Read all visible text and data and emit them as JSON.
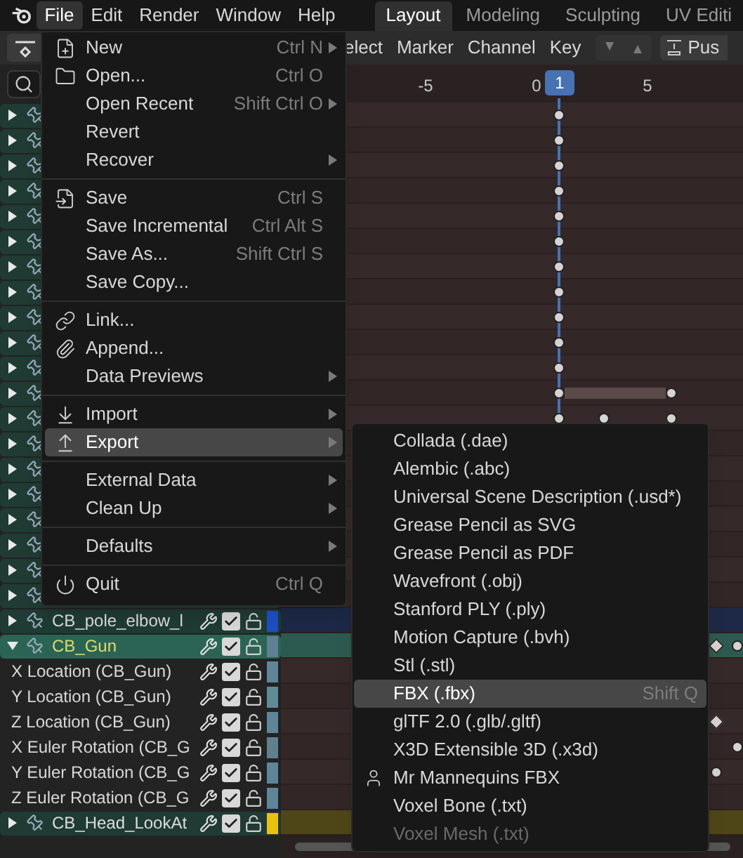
{
  "menubar": {
    "items": [
      {
        "label": "File",
        "selected": true
      },
      {
        "label": "Edit",
        "selected": false
      },
      {
        "label": "Render",
        "selected": false
      },
      {
        "label": "Window",
        "selected": false
      },
      {
        "label": "Help",
        "selected": false
      }
    ]
  },
  "workspace_tabs": [
    {
      "label": "Layout",
      "selected": true
    },
    {
      "label": "Modeling",
      "selected": false
    },
    {
      "label": "Sculpting",
      "selected": false
    },
    {
      "label": "UV Editi",
      "selected": false
    }
  ],
  "editor_header": {
    "menus": [
      "elect",
      "Marker",
      "Channel",
      "Key"
    ],
    "push_button": "Pus"
  },
  "ruler": {
    "ticks": [
      "-5",
      "0",
      "5"
    ],
    "current_frame": "1"
  },
  "channels": [
    {
      "kind": "group",
      "expanded": false
    },
    {
      "kind": "group",
      "expanded": false
    },
    {
      "kind": "group",
      "expanded": false
    },
    {
      "kind": "group",
      "expanded": false
    },
    {
      "kind": "group",
      "expanded": false
    },
    {
      "kind": "group",
      "expanded": false
    },
    {
      "kind": "group",
      "expanded": false
    },
    {
      "kind": "group",
      "expanded": false
    },
    {
      "kind": "group",
      "expanded": false
    },
    {
      "kind": "group",
      "expanded": false
    },
    {
      "kind": "group",
      "expanded": false
    },
    {
      "kind": "group",
      "expanded": false
    },
    {
      "kind": "group",
      "expanded": false
    },
    {
      "kind": "group",
      "expanded": false
    },
    {
      "kind": "group",
      "expanded": false
    },
    {
      "kind": "group",
      "expanded": false
    },
    {
      "kind": "group",
      "expanded": false
    },
    {
      "kind": "group",
      "expanded": false
    },
    {
      "kind": "group",
      "expanded": false
    },
    {
      "kind": "group",
      "expanded": false
    },
    {
      "kind": "group",
      "name": "CB_pole_elbow_l",
      "expanded": false,
      "selected": false,
      "checked": true,
      "color": "#1f4fc4"
    },
    {
      "kind": "group",
      "name": "CB_Gun",
      "expanded": true,
      "selected": true,
      "checked": true,
      "color": "#5f7f94"
    },
    {
      "kind": "curve",
      "name": "X Location (CB_Gun)",
      "checked": true,
      "color": "#5f8598"
    },
    {
      "kind": "curve",
      "name": "Y Location (CB_Gun)",
      "checked": true,
      "color": "#5f8b98"
    },
    {
      "kind": "curve",
      "name": "Z Location (CB_Gun)",
      "checked": true,
      "color": "#5f8598"
    },
    {
      "kind": "curve",
      "name": "X Euler Rotation (CB_G",
      "checked": true,
      "color": "#61808e"
    },
    {
      "kind": "curve",
      "name": "Y Euler Rotation (CB_G",
      "checked": true,
      "color": "#5f8598"
    },
    {
      "kind": "curve",
      "name": "Z Euler Rotation (CB_G",
      "checked": true,
      "color": "#5f8598"
    },
    {
      "kind": "group",
      "name": "CB_Head_LookAt",
      "expanded": false,
      "selected": false,
      "checked": true,
      "color": "#e8c20c"
    }
  ],
  "file_menu": {
    "sections": [
      [
        {
          "label": "New",
          "shortcut": "Ctrl N",
          "submenu": true,
          "selected": false
        },
        {
          "label": "Open...",
          "shortcut": "Ctrl O",
          "submenu": false,
          "selected": false
        },
        {
          "label": "Open Recent",
          "shortcut": "Shift Ctrl O",
          "submenu": true,
          "selected": false
        },
        {
          "label": "Revert",
          "submenu": false,
          "selected": false
        },
        {
          "label": "Recover",
          "submenu": true,
          "selected": false
        }
      ],
      [
        {
          "label": "Save",
          "shortcut": "Ctrl S",
          "submenu": false,
          "selected": false
        },
        {
          "label": "Save Incremental",
          "shortcut": "Ctrl Alt S",
          "submenu": false,
          "selected": false
        },
        {
          "label": "Save As...",
          "shortcut": "Shift Ctrl S",
          "submenu": false,
          "selected": false
        },
        {
          "label": "Save Copy...",
          "submenu": false,
          "selected": false
        }
      ],
      [
        {
          "label": "Link...",
          "submenu": false,
          "selected": false
        },
        {
          "label": "Append...",
          "submenu": false,
          "selected": false
        },
        {
          "label": "Data Previews",
          "submenu": true,
          "selected": false
        }
      ],
      [
        {
          "label": "Import",
          "submenu": true,
          "selected": false
        },
        {
          "label": "Export",
          "submenu": true,
          "selected": true
        }
      ],
      [
        {
          "label": "External Data",
          "submenu": true,
          "selected": false
        },
        {
          "label": "Clean Up",
          "submenu": true,
          "selected": false
        }
      ],
      [
        {
          "label": "Defaults",
          "submenu": true,
          "selected": false
        }
      ],
      [
        {
          "label": "Quit",
          "shortcut": "Ctrl Q",
          "submenu": false,
          "selected": false
        }
      ]
    ]
  },
  "export_menu": {
    "items": [
      {
        "label": "Collada (.dae)",
        "selected": false,
        "disabled": false
      },
      {
        "label": "Alembic (.abc)",
        "selected": false,
        "disabled": false
      },
      {
        "label": "Universal Scene Description (.usd*)",
        "selected": false,
        "disabled": false
      },
      {
        "label": "Grease Pencil as SVG",
        "selected": false,
        "disabled": false
      },
      {
        "label": "Grease Pencil as PDF",
        "selected": false,
        "disabled": false
      },
      {
        "label": "Wavefront (.obj)",
        "selected": false,
        "disabled": false
      },
      {
        "label": "Stanford PLY (.ply)",
        "selected": false,
        "disabled": false
      },
      {
        "label": "Motion Capture (.bvh)",
        "selected": false,
        "disabled": false
      },
      {
        "label": "Stl (.stl)",
        "selected": false,
        "disabled": false
      },
      {
        "label": "FBX (.fbx)",
        "shortcut": "Shift Q",
        "selected": true,
        "disabled": false
      },
      {
        "label": "glTF 2.0 (.glb/.gltf)",
        "selected": false,
        "disabled": false
      },
      {
        "label": "X3D Extensible 3D (.x3d)",
        "selected": false,
        "disabled": false
      },
      {
        "label": "Mr Mannequins FBX",
        "selected": false,
        "disabled": false
      },
      {
        "label": "Voxel Bone (.txt)",
        "selected": false,
        "disabled": false
      },
      {
        "label": "Voxel Mesh (.txt)",
        "selected": false,
        "disabled": true
      }
    ]
  }
}
